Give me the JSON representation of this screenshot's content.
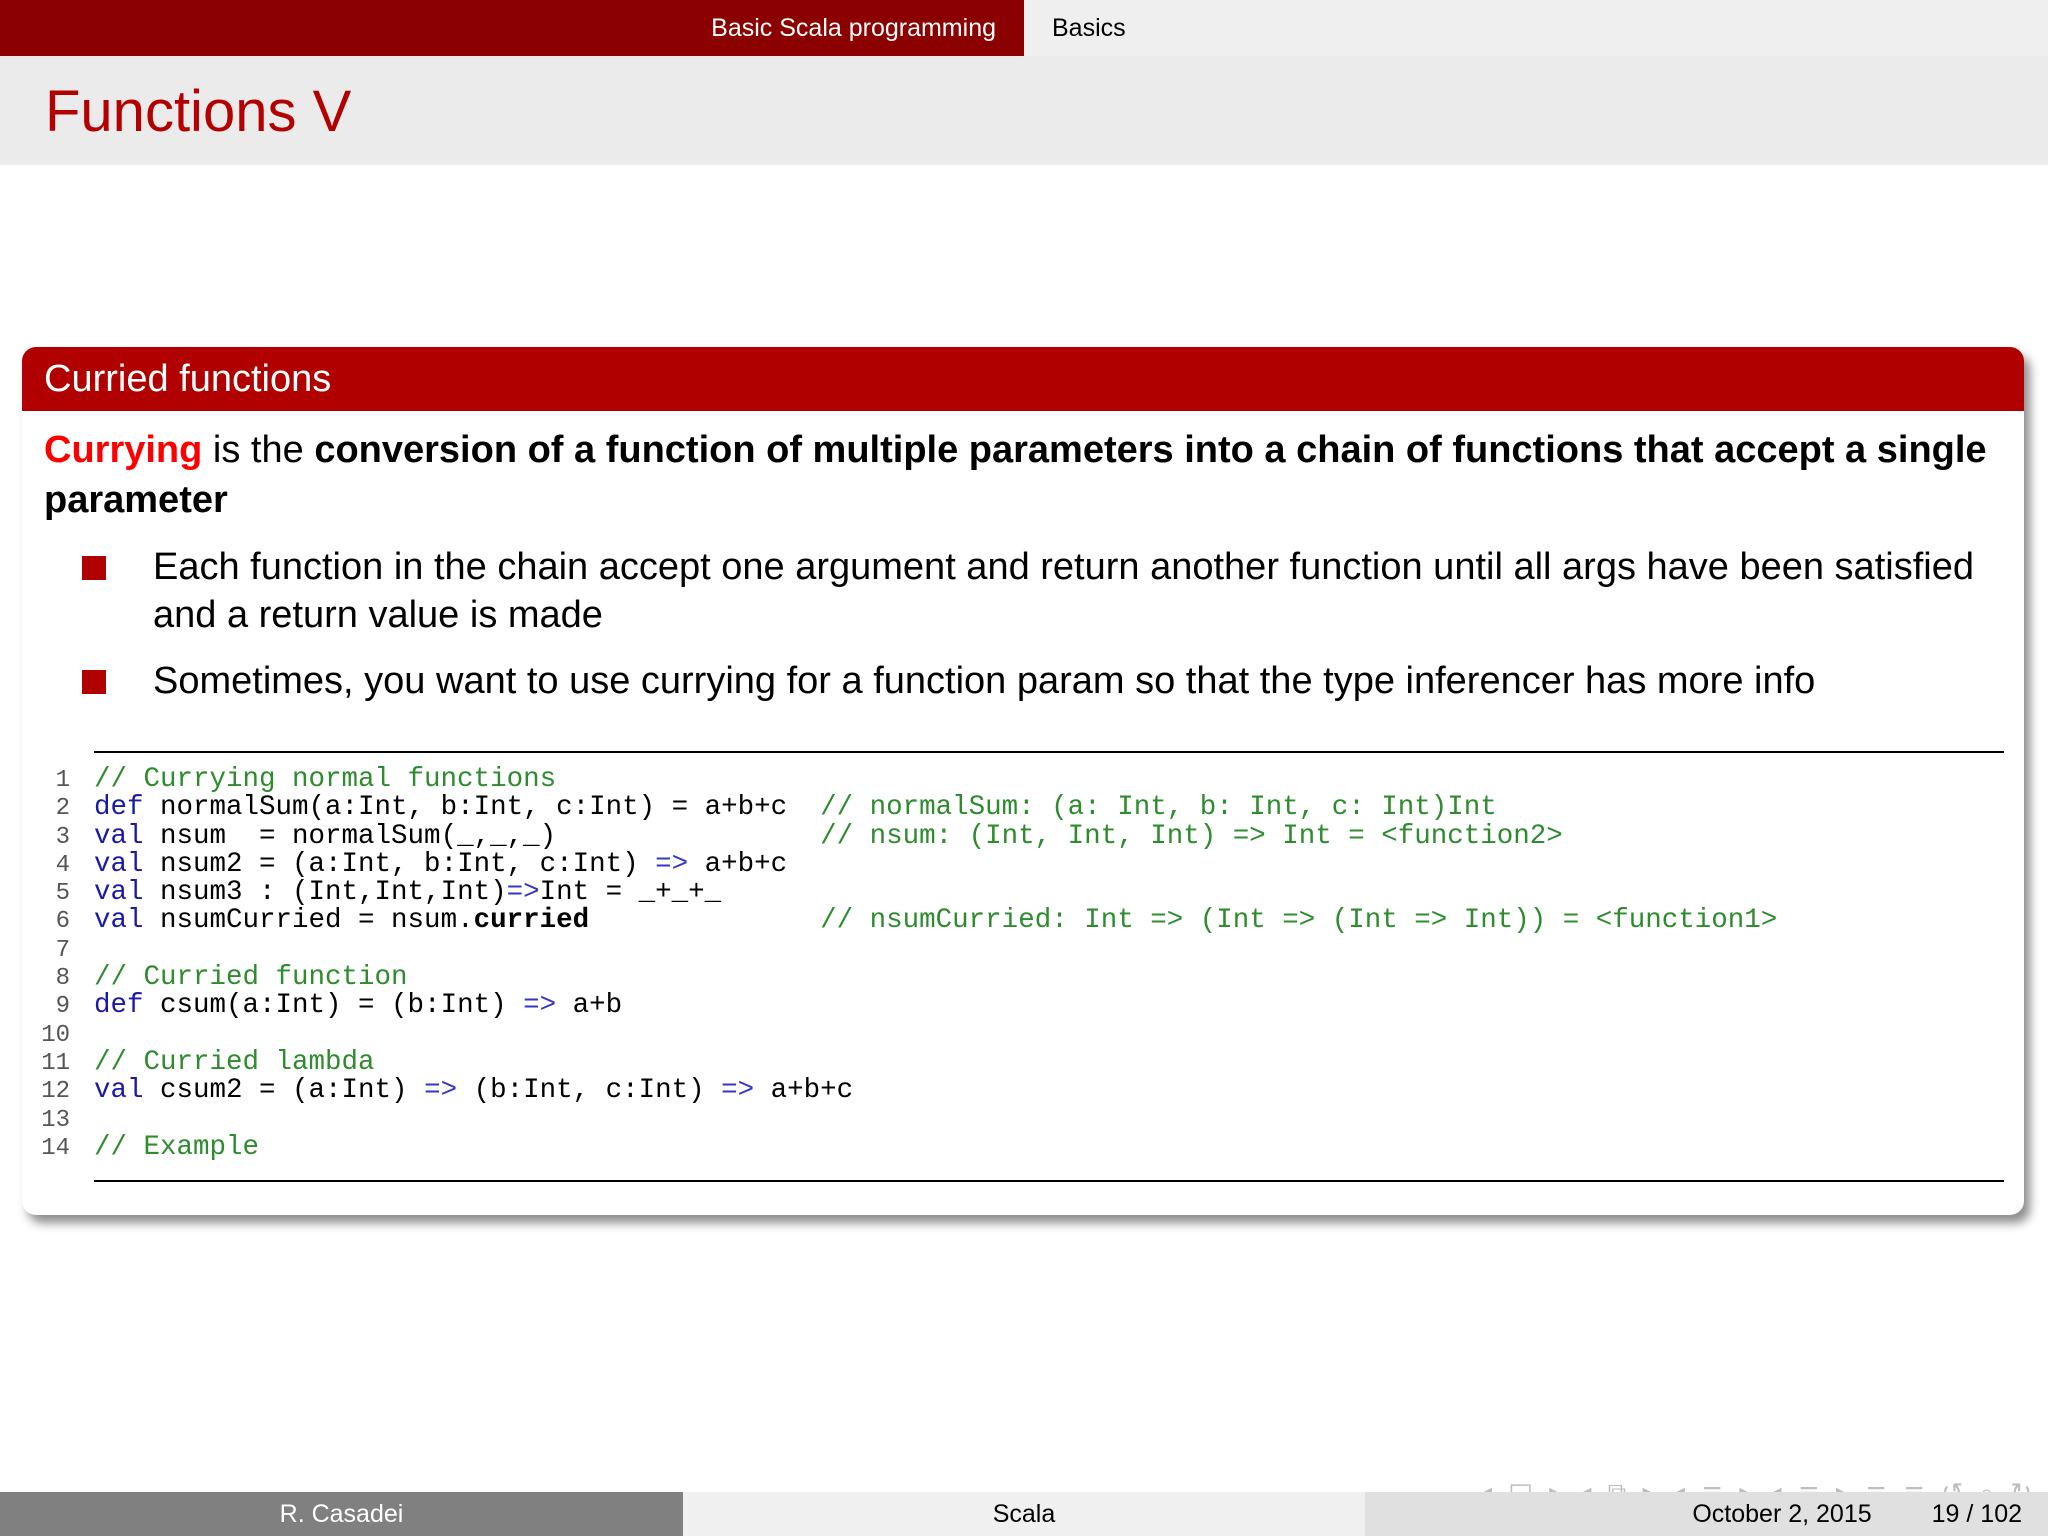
{
  "topbar": {
    "section": "Basic Scala programming",
    "subsection": "Basics"
  },
  "frame": {
    "title": "Functions V"
  },
  "block": {
    "title": "Curried functions",
    "lead": {
      "term": "Currying",
      "is": " is the ",
      "definition": "conversion of a function of multiple parameters into a chain of functions that accept a single parameter"
    },
    "bullets": [
      "Each function in the chain accept one argument and return another function until all args have been satisfied and a return value is made",
      "Sometimes, you want to use currying for a function param so that the type inferencer has more info"
    ]
  },
  "code": {
    "line_numbers": [
      "1",
      "2",
      "3",
      "4",
      "5",
      "6",
      "7",
      "8",
      "9",
      "10",
      "11",
      "12",
      "13",
      "14"
    ],
    "lines": [
      "// Currying normal functions",
      "def normalSum(a:Int, b:Int, c:Int) = a+b+c  // normalSum: (a: Int, b: Int, c: Int)Int",
      "val nsum  = normalSum(_,_,_)                // nsum: (Int, Int, Int) => Int = <function2>",
      "val nsum2 = (a:Int, b:Int, c:Int) => a+b+c",
      "val nsum3 : (Int,Int,Int)=>Int = _+_+_",
      "val nsumCurried = nsum.curried              // nsumCurried: Int => (Int => (Int => Int)) = <function1>",
      "",
      "// Curried function",
      "def csum(a:Int) = (b:Int) => a+b",
      "",
      "// Curried lambda",
      "val csum2 = (a:Int) => (b:Int, c:Int) => a+b+c",
      "",
      "// Example"
    ]
  },
  "navigation": {
    "symbols": "◂ □ ▸ ◂ ⧉ ▸ ◂ ≡ ▸ ◂ ≡ ▸ ≡ ≡ ↺ ⌕ ↻"
  },
  "footer": {
    "author": "R. Casadei",
    "title": "Scala",
    "date": "October 2, 2015",
    "page": "19 / 102"
  }
}
